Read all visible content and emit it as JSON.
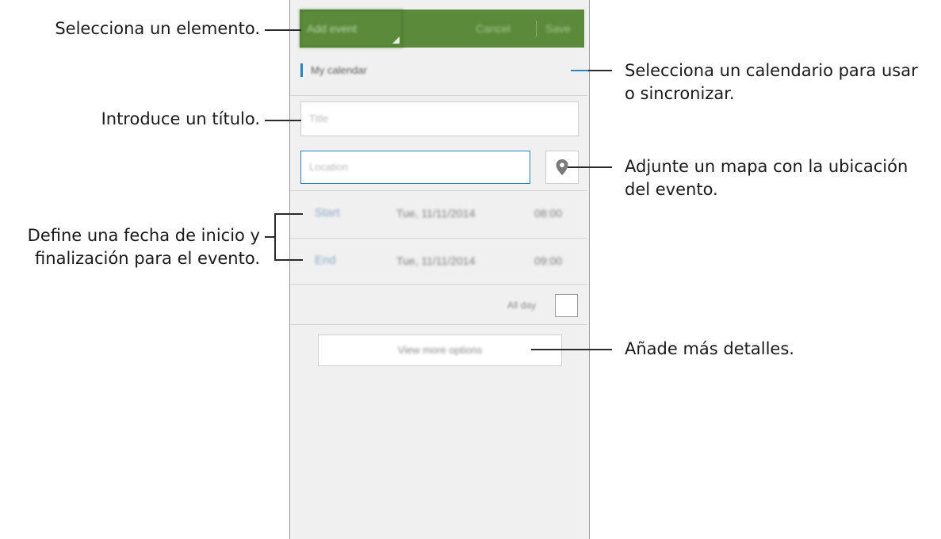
{
  "phone": {
    "action_bar": {
      "dropdown_label": "Add event",
      "cancel_label": "Cancel",
      "save_label": "Save",
      "color": "#5a8a3a"
    },
    "calendar_label": "My calendar",
    "title_placeholder": "Title",
    "location_placeholder": "Location",
    "map_icon": "map-pin-icon",
    "start": {
      "label": "Start",
      "date": "Tue, 11/11/2014",
      "time": "08:00"
    },
    "end": {
      "label": "End",
      "date": "Tue, 11/11/2014",
      "time": "09:00"
    },
    "all_day_label": "All day",
    "more_options_label": "View more options",
    "accent": "#2a86b8"
  },
  "annotations": {
    "select_item": "Selecciona un elemento.",
    "enter_title": "Introduce un título.",
    "date_line1": "Define una fecha de inicio y",
    "date_line2": "finalización para el evento.",
    "calendar_line1": "Selecciona un calendario para usar",
    "calendar_line2": "o sincronizar.",
    "map_line1": "Adjunte un mapa con la ubicación",
    "map_line2": "del evento.",
    "more_details": "Añade más detalles."
  }
}
